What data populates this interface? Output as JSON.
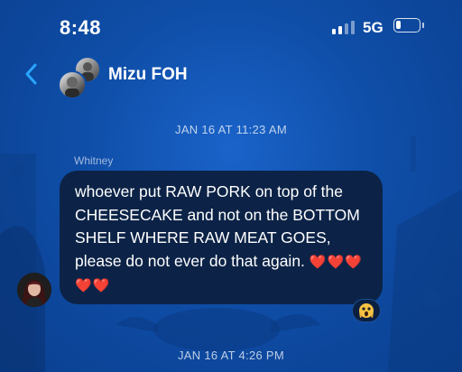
{
  "status_bar": {
    "time": "8:48",
    "network": "5G",
    "signal_bars": 4,
    "signal_bars_filled": 2,
    "battery_level": 0.2,
    "icons": [
      "signal-icon",
      "battery-icon"
    ]
  },
  "header": {
    "back_icon": "chevron-left-icon",
    "title": "Mizu FOH"
  },
  "messages": {
    "timestamp_1": "JAN 16 AT 11:23 AM",
    "sender_name": "Whitney",
    "message_text": "whoever put RAW PORK on top of the CHEESECAKE and not on the BOTTOM SHELF WHERE RAW MEAT GOES, please do not ever do that again.",
    "message_hearts": "❤️❤️❤️❤️❤️",
    "reaction_icon": "scream-face-emoji-icon",
    "timestamp_2": "JAN 16 AT 4:26 PM"
  },
  "colors": {
    "background": "#0f4ea8",
    "bubble": "#0c2347",
    "accent_blue": "#2aa5ff"
  }
}
